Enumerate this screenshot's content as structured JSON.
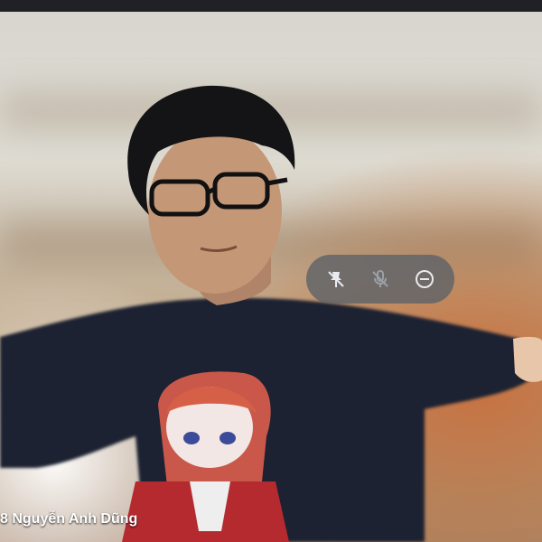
{
  "participant": {
    "name": "8 Nguyễn Anh Dũng"
  },
  "controls": {
    "pin_icon": "pin-off-icon",
    "mute_icon": "mic-off-icon",
    "remove_icon": "remove-icon"
  },
  "colors": {
    "control_pill": "#5f6368",
    "top_bar": "#202124",
    "label_text": "#ffffff"
  }
}
